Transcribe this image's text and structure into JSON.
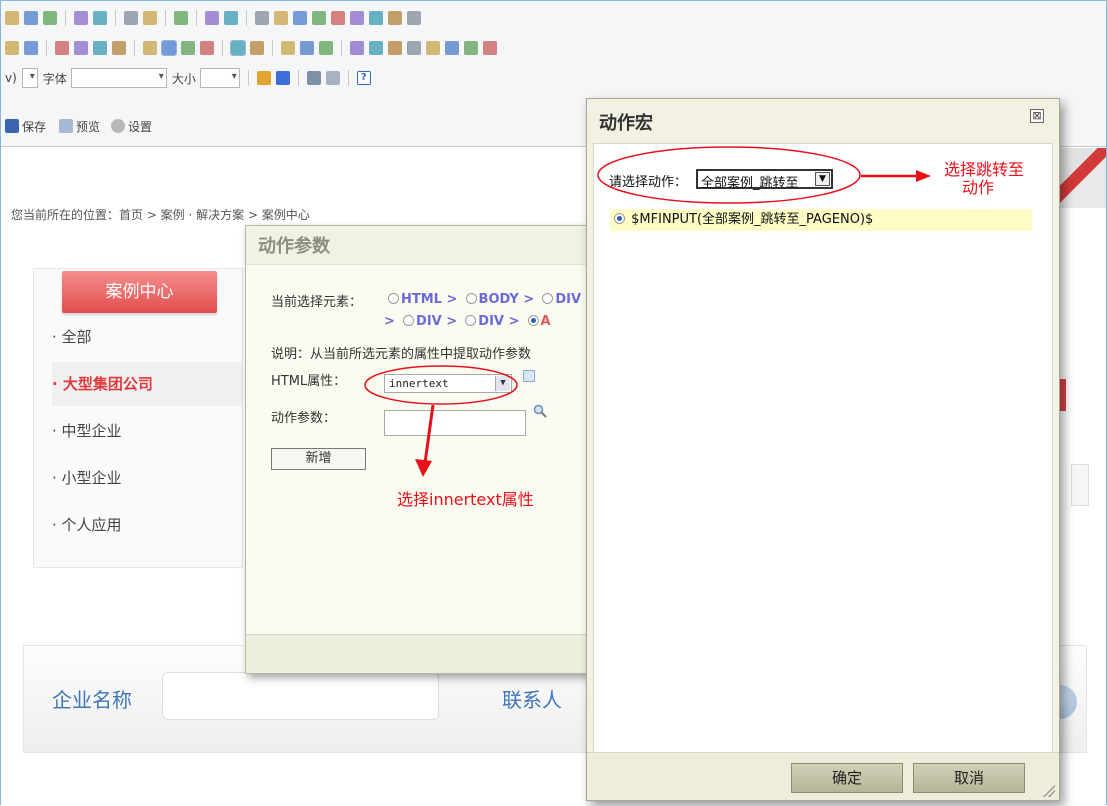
{
  "toolbar": {
    "font_label": "字体",
    "size_label": "大小",
    "save_label": "保存",
    "preview_label": "预览",
    "settings_label": "设置",
    "help_label": "?",
    "row1_icons": [
      "paste-icon",
      "paste-text-icon",
      "paste-word-icon",
      "sep",
      "undo-icon",
      "redo-icon",
      "sep",
      "find-icon",
      "replace-icon",
      "sep",
      "select-all-icon",
      "sep",
      "spellcheck-icon",
      "spellcheck-options-icon",
      "sep",
      "form-icon",
      "checkbox-icon",
      "radio-icon",
      "textfield-icon",
      "textarea-icon",
      "select-field-icon",
      "button-field-icon",
      "image-button-icon",
      "hidden-field-icon"
    ],
    "row2_icons": [
      "numbered-list-icon",
      "bulleted-list-icon",
      "sep",
      "outdent-icon",
      "indent-icon",
      "blockquote-icon",
      "div-container-icon",
      "sep",
      "align-left-icon",
      "align-center-icon",
      "align-right-icon",
      "justify-icon",
      "sep",
      "ltr-icon",
      "rtl-icon",
      "sep",
      "link-icon",
      "unlink-icon",
      "anchor-icon",
      "sep",
      "image-icon",
      "flash-icon",
      "table-icon",
      "horizontal-rule-icon",
      "smiley-icon",
      "special-char-icon",
      "page-break-icon",
      "iframe-icon"
    ]
  },
  "page": {
    "breadcrumb": "您当前所在的位置：首页 > 案例 · 解决方案 > 案例中心",
    "sidebar_title": "案例中心",
    "sidebar_items": [
      "· 全部",
      "· 大型集团公司",
      "· 中型企业",
      "· 小型企业",
      "· 个人应用"
    ],
    "company_label": "企业名称",
    "contact_label": "联系人"
  },
  "dialog_params": {
    "title": "动作参数",
    "current_elem_label": "当前选择元素：",
    "elems_row1": [
      "HTML >",
      "BODY >",
      "DIV"
    ],
    "elems_row2": [
      ">",
      "DIV >",
      "DIV >",
      "A"
    ],
    "description": "说明：从当前所选元素的属性中提取动作参数",
    "html_attr_label": "HTML属性：",
    "html_attr_value": "innertext",
    "action_param_label": "动作参数：",
    "add_button": "新增"
  },
  "dialog_macro": {
    "title": "动作宏",
    "close_icon": "⊠",
    "select_action_label": "请选择动作：",
    "select_action_value": "全部案例_跳转至",
    "macro_value": "$MFINPUT(全部案例_跳转至_PAGENO)$",
    "ok_button": "确定",
    "cancel_button": "取消"
  },
  "annotations": {
    "select_jump_line1": "选择跳转至",
    "select_jump_line2": "动作",
    "select_innertext": "选择innertext属性"
  },
  "colors": {
    "annotation_red": "#e8101a",
    "sidebar_active": "#e0393e",
    "label_blue": "#3e76b8",
    "macro_highlight": "#fdfdc5"
  }
}
